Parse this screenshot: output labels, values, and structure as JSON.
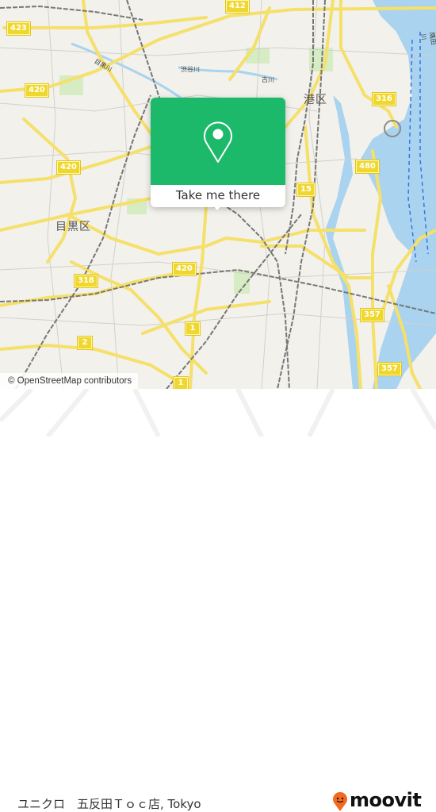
{
  "map": {
    "districts": [
      {
        "name": "港区"
      },
      {
        "name": "目黒区"
      }
    ],
    "river_labels": [
      "目黒川",
      "渋谷川",
      "古川",
      "隅田川"
    ],
    "road_badges": [
      "423",
      "412",
      "420",
      "420",
      "316",
      "480",
      "15",
      "420",
      "318",
      "2",
      "1",
      "357",
      "357",
      "1"
    ],
    "colors": {
      "background": "#f2f1ec",
      "road": "#f5e06a",
      "water": "#a9d3ee",
      "rail": "#777777",
      "park": "#d6ecc2"
    },
    "attribution": "© OpenStreetMap contributors"
  },
  "popup": {
    "label": "Take me there",
    "icon": "location-pin-icon",
    "color": "#1db96a"
  },
  "footer": {
    "place_name": "ユニクロ　五反田Ｔｏｃ店, Tokyo",
    "brand": "moovit",
    "brand_color": "#f26a21"
  }
}
